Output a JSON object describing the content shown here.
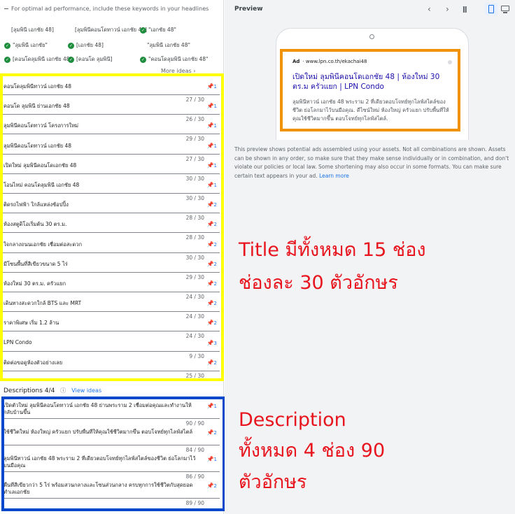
{
  "left_panel": {
    "tip": "For optimal ad performance, include these keywords in your headlines",
    "keywords": [
      {
        "text": "[ลุมพินี เอกชัย 48]",
        "checked": false
      },
      {
        "text": "[ลุมพินีคอนโดทาวน์ เอกชัย 48]",
        "checked": false
      },
      {
        "text": "\"เอกชัย 48\"",
        "checked": true
      },
      {
        "text": "\"ลุมพินี เอกชัย\"",
        "checked": true
      },
      {
        "text": "[เอกชัย 48]",
        "checked": true
      },
      {
        "text": "\"ลุมพินี เอกชัย 48\"",
        "checked": false
      },
      {
        "text": "[คอนโดลุมพินี เอกชัย 48]",
        "checked": true
      },
      {
        "text": "[คอนโด ลุมพินี]",
        "checked": true
      },
      {
        "text": "\"คอนโดลุมพินี เอกชัย 48\"",
        "checked": true
      }
    ],
    "more_ideas": "More ideas",
    "headlines": [
      {
        "text": "คอนโดลุมพินีทาวน์ เอกชัย 48",
        "pin": "1",
        "count": "27 / 30"
      },
      {
        "text": "คอนโด ลุมพินี ย่านเอกชัย 48",
        "pin": "1",
        "count": "26 / 30"
      },
      {
        "text": "ลุมพินีคอนโดทาวน์ โครงการใหม่",
        "pin": "1",
        "count": "29 / 30"
      },
      {
        "text": "ลุมพินีคอนโดทาวน์ เอกชัย 48",
        "pin": "1",
        "count": "27 / 30"
      },
      {
        "text": "เปิดใหม่ ลุมพินีคอนโดเอกชัย 48",
        "pin": "1",
        "count": "30 / 30"
      },
      {
        "text": "โอนไหม่ คอนโดลุมพินี เอกชัย 48",
        "pin": "1",
        "count": "30 / 30"
      },
      {
        "text": "ติดรถไฟฟ้า ใกล้แหล่งช้อปปิ้ง",
        "pin": "2",
        "count": "28 / 30"
      },
      {
        "text": "ห้องสตูดิโอเริ่มต้น 30 ตร.ม.",
        "pin": "2",
        "count": "28 / 30"
      },
      {
        "text": "ใจกลางถนนเอกชัย เชื่อมต่อสะดวก",
        "pin": "2",
        "count": "30 / 30"
      },
      {
        "text": "มีโซนพื้นที่สีเขียวขนาด 5 ไร่",
        "pin": "2",
        "count": "29 / 30"
      },
      {
        "text": "ห้องใหม่ 30 ตร.ม. ครัวแยก",
        "pin": "2",
        "count": "24 / 30"
      },
      {
        "text": "เดินทางสะดวกใกล้ BTS และ MRT",
        "pin": "2",
        "count": "24 / 30"
      },
      {
        "text": "ราคาพิเศษ เริ่ม 1.2 ล้าน",
        "pin": "2",
        "count": "24 / 30"
      },
      {
        "text": "LPN Condo",
        "pin": "3",
        "count": "9 / 30"
      },
      {
        "text": "ติดต่อขอดูห้องตัวอย่างเลย",
        "pin": "2",
        "count": "25 / 30"
      }
    ],
    "descriptions_label": "Descriptions 4/4",
    "view_ideas": "View ideas",
    "descriptions": [
      {
        "text": "เปิดตัวใหม่ ลุมพินีคอนโดทาวน์ เอกชัย 48 ย่านพระราม 2 เชื่อมต่อคุณและทำงานให้กลับบ้านขึ้น",
        "pin": "1",
        "count": "90 / 90"
      },
      {
        "text": "ใช้ชีวิตใหม่ ห้องใหญ่ ครัวแยก ปรับพื้นที่ให้คุณใช้ชีวิตมากขึ้น ตอบโจทย์ทุกไลฟ์สไตล์",
        "pin": "2",
        "count": "84 / 90"
      },
      {
        "text": "ลุมพินีทาวน์ เอกชัย 48 พระราม 2 ที่เดียวตอบโจทย์ทุกไลฟ์สไตล์ของชีวิต ย่อโลกมาไว้บนมือคุณ",
        "pin": "1",
        "count": "86 / 90"
      },
      {
        "text": "พื้นที่สีเขียวกว่า 5 ไร่ พร้อมสวนกลางและโซนส่วนกลาง ครบทุกการใช้ชีวิตกับสุดยอดทำเลเอกชัย",
        "pin": "2",
        "count": "89 / 90"
      }
    ]
  },
  "preview": {
    "label": "Preview",
    "ad_badge": "Ad",
    "ad_url": "www.lpn.co.th/ekachai48",
    "ad_title": "เปิดใหม่ ลุมพินีคอนโดเอกชัย 48 | ห้องใหม่ 30 ตร.ม ครัวแยก | LPN Condo",
    "ad_desc": "ลุมพินีทาวน์ เอกชัย 48 พระราม 2 ที่เดียวตอบโจทย์ทุกไลฟ์สไตล์ของชีวิต ย่อโลกมาไว้บนมือคุณ. ดีไซน์ใหม่ ห้องใหญ่ ครัวแยก ปรับพื้นที่ให้คุณใช้ชีวิตมากขึ้น ตอบโจทย์ทุกไลฟ์สไตล์.",
    "notice": "This preview shows potential ads assembled using your assets. Not all combinations are shown. Assets can be shown in any order, so make sure that they make sense individually or in combination, and don't violate our policies or local law. Some shortening may also occur in some formats. You can make sure certain text appears in your ad.",
    "learn_more": "Learn more"
  },
  "annotations": {
    "title_line1": "Title มีทั้งหมด 15 ช่อง",
    "title_line2": "ช่องละ 30 ตัวอักษร",
    "desc_line1": "Description",
    "desc_line2": "ทั้งหมด 4 ช่อง 90",
    "desc_line3": "ตัวอักษร"
  },
  "colors": {
    "title_box": "#ffff00",
    "desc_box": "#0047cc",
    "ad_box": "#f0930b",
    "annotation": "#e8141e"
  }
}
